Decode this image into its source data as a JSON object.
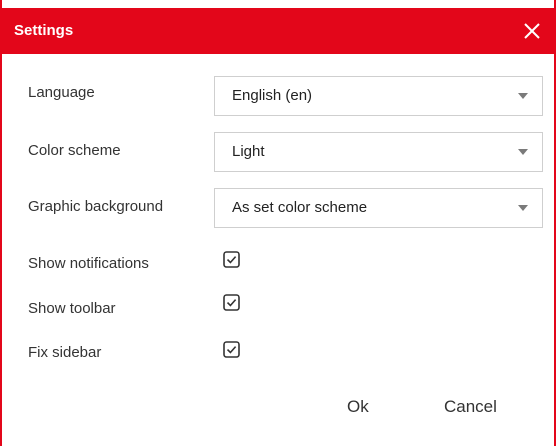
{
  "dialog": {
    "title": "Settings",
    "accent_color": "#e3061a",
    "close_icon": "close-icon"
  },
  "fields": {
    "language": {
      "label": "Language",
      "value": "English (en)"
    },
    "color_scheme": {
      "label": "Color scheme",
      "value": "Light"
    },
    "graphic_background": {
      "label": "Graphic background",
      "value": "As set color scheme"
    }
  },
  "options": {
    "show_notifications": {
      "label": "Show notifications",
      "checked": true
    },
    "show_toolbar": {
      "label": "Show toolbar",
      "checked": true
    },
    "fix_sidebar": {
      "label": "Fix sidebar",
      "checked": true
    }
  },
  "buttons": {
    "ok_label": "Ok",
    "cancel_label": "Cancel"
  }
}
